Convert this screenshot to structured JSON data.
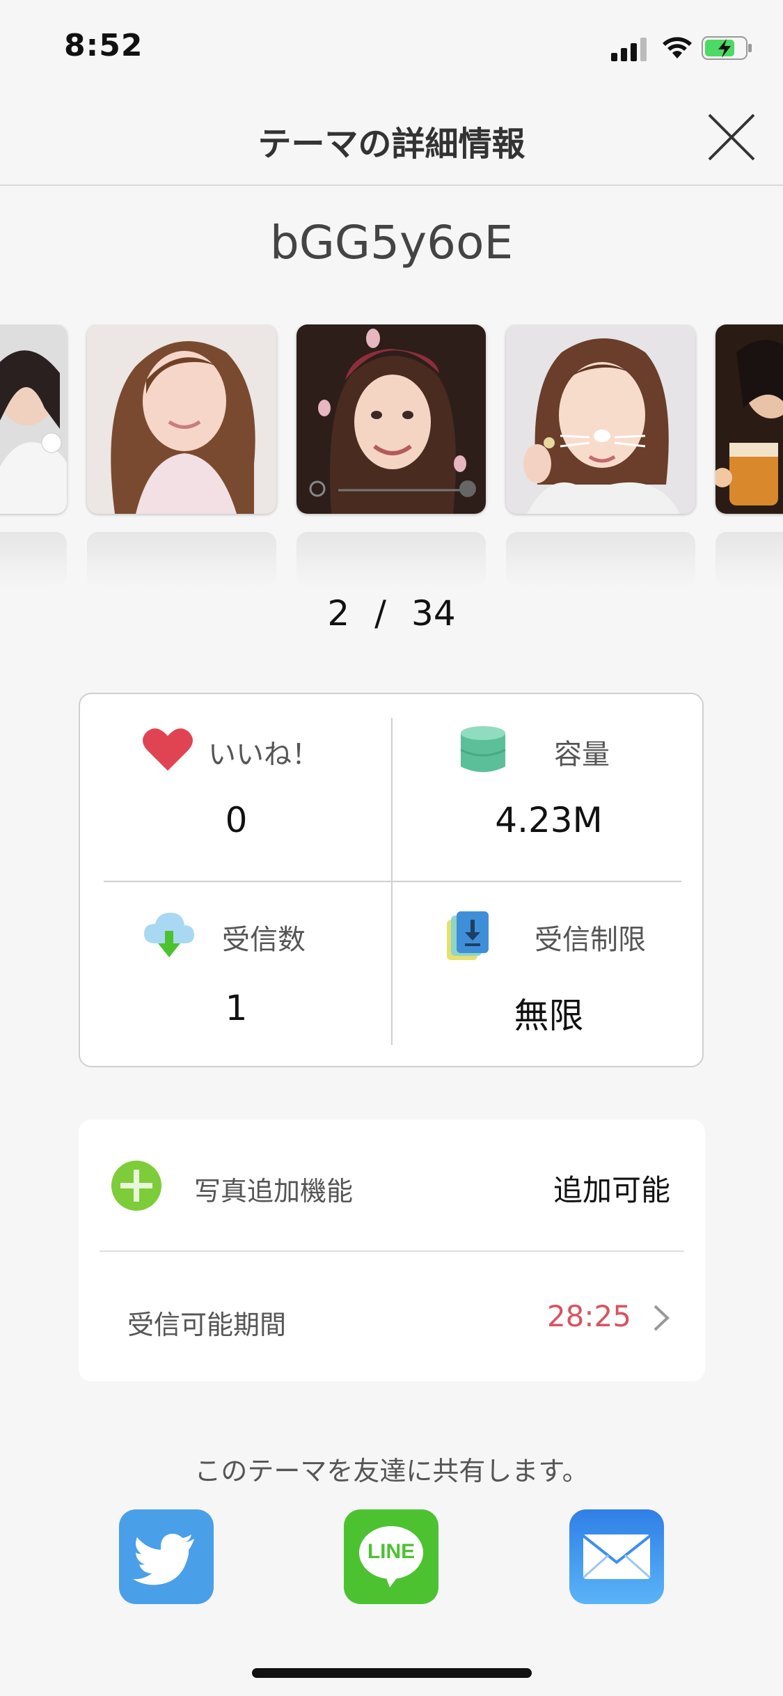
{
  "status_bar": {
    "time": "8:52"
  },
  "header": {
    "title": "テーマの詳細情報"
  },
  "theme": {
    "code": "bGG5y6oE"
  },
  "carousel": {
    "current": "2",
    "separator": "/",
    "total": "34"
  },
  "stats": {
    "likes": {
      "label": "いいね！",
      "value": "0"
    },
    "capacity": {
      "label": "容量",
      "value": "4.23M"
    },
    "received": {
      "label": "受信数",
      "value": "1"
    },
    "limit": {
      "label": "受信制限",
      "value": "無限"
    }
  },
  "options": {
    "photo_add": {
      "label": "写真追加機能",
      "value": "追加可能"
    },
    "period": {
      "label": "受信可能期間",
      "value": "28:25"
    }
  },
  "share": {
    "caption": "このテーマを友達に共有します。",
    "line_label": "LINE"
  },
  "colors": {
    "twitter": "#4a9fe9",
    "line": "#4cc231",
    "mail": "#3b8ff0",
    "heart": "#e04452",
    "red_value": "#d9535f"
  }
}
